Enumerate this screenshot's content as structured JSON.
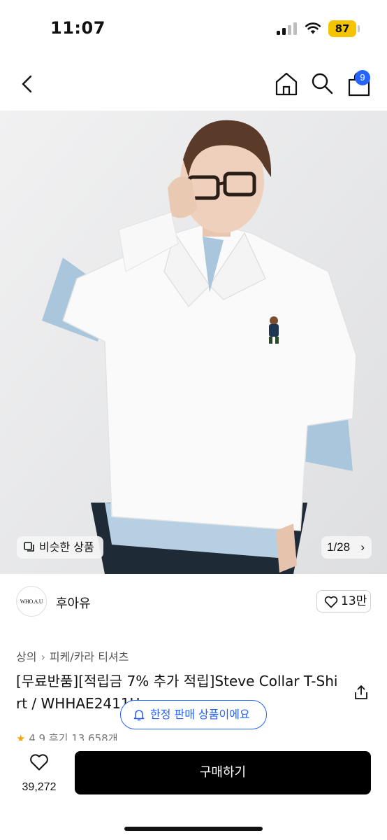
{
  "status_bar": {
    "time": "11:07",
    "battery": "87"
  },
  "header": {
    "cart_count": "9"
  },
  "hero": {
    "similar_label": "비슷한 상품",
    "image_counter": "1/28",
    "counter_chevron": "›"
  },
  "brand": {
    "logo_text": "WHO.A.U",
    "name": "후아유",
    "likes": "13만"
  },
  "breadcrumb": {
    "category": "상의",
    "separator": "›",
    "subcategory": "피케/카라 티셔츠"
  },
  "product": {
    "title": "[무료반품][적립금 7% 추가 적립]Steve Collar T-Shirt / WHHAE2411U",
    "rating_star": "★",
    "rating": "4.9",
    "reviews": "후기 13,658개"
  },
  "toast": {
    "limited_label": "한정 판매 상품이에요"
  },
  "bottom_bar": {
    "wish_count": "39,272",
    "buy_label": "구매하기"
  },
  "colors": {
    "accent": "#2563ff",
    "battery": "#f5c400",
    "buy_button": "#000000",
    "star": "#f5a700"
  }
}
